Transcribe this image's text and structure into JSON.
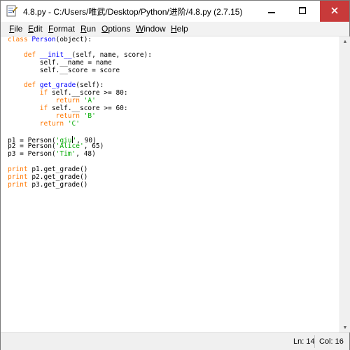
{
  "window": {
    "title": "4.8.py - C:/Users/唯武/Desktop/Python/进阶/4.8.py (2.7.15)",
    "app_icon": "python-idle-icon",
    "controls": {
      "minimize": "minimize-icon",
      "maximize": "maximize-icon",
      "close": "close-icon"
    },
    "accent_close": "#c83a3a"
  },
  "menu": [
    {
      "label": "File",
      "underline": "F",
      "rest": "ile"
    },
    {
      "label": "Edit",
      "underline": "E",
      "rest": "dit"
    },
    {
      "label": "Format",
      "underline": "F",
      "rest": "ormat"
    },
    {
      "label": "Run",
      "underline": "R",
      "rest": "un"
    },
    {
      "label": "Options",
      "underline": "O",
      "rest": "ptions"
    },
    {
      "label": "Window",
      "underline": "W",
      "rest": "indow"
    },
    {
      "label": "Help",
      "underline": "H",
      "rest": "elp"
    }
  ],
  "code_lines": [
    [
      [
        "kw",
        "class "
      ],
      [
        "fn",
        "Person"
      ],
      [
        "",
        "(object):"
      ]
    ],
    [],
    [
      [
        "",
        "    "
      ],
      [
        "kw",
        "def "
      ],
      [
        "fn",
        "__init__"
      ],
      [
        "",
        "(self, name, score):"
      ]
    ],
    [
      [
        "",
        "        self.__name = name"
      ]
    ],
    [
      [
        "",
        "        self.__score = score"
      ]
    ],
    [],
    [
      [
        "",
        "    "
      ],
      [
        "kw",
        "def "
      ],
      [
        "fn",
        "get_grade"
      ],
      [
        "",
        "(self):"
      ]
    ],
    [
      [
        "",
        "        "
      ],
      [
        "kw",
        "if"
      ],
      [
        "",
        " self.__score >= 80:"
      ]
    ],
    [
      [
        "",
        "            "
      ],
      [
        "kw",
        "return "
      ],
      [
        "st",
        "'A'"
      ]
    ],
    [
      [
        "",
        "        "
      ],
      [
        "kw",
        "if"
      ],
      [
        "",
        " self.__score >= 60:"
      ]
    ],
    [
      [
        "",
        "            "
      ],
      [
        "kw",
        "return "
      ],
      [
        "st",
        "'B'"
      ]
    ],
    [
      [
        "",
        "        "
      ],
      [
        "kw",
        "return "
      ],
      [
        "st",
        "'C'"
      ]
    ],
    [],
    [
      [
        "",
        "p1 = Person("
      ],
      [
        "st",
        "'qiu"
      ],
      [
        "cursor",
        ""
      ],
      [
        "st",
        "'"
      ],
      [
        "",
        ", 90)"
      ]
    ],
    [
      [
        "",
        "p2 = Person("
      ],
      [
        "st",
        "'Alice'"
      ],
      [
        "",
        ", 65)"
      ]
    ],
    [
      [
        "",
        "p3 = Person("
      ],
      [
        "st",
        "'Tim'"
      ],
      [
        "",
        ", 48)"
      ]
    ],
    [],
    [
      [
        "kw",
        "print"
      ],
      [
        "",
        " p1.get_grade()"
      ]
    ],
    [
      [
        "kw",
        "print"
      ],
      [
        "",
        " p2.get_grade()"
      ]
    ],
    [
      [
        "kw",
        "print"
      ],
      [
        "",
        " p3.get_grade()"
      ]
    ]
  ],
  "syntax_colors": {
    "keyword": "#ff7700",
    "definition": "#0000ff",
    "string": "#00aa00"
  },
  "status": {
    "line": "Ln: 14",
    "col": "Col: 16"
  }
}
